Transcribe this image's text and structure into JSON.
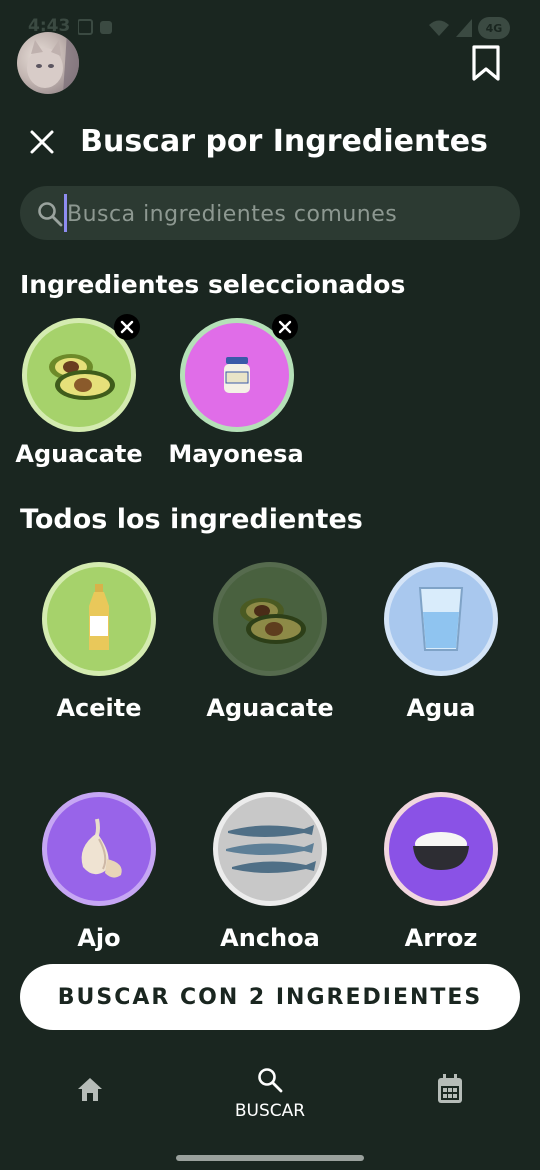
{
  "status_bar": {
    "time": "4:43",
    "network": "4G"
  },
  "header": {
    "title": "Buscar por Ingredientes"
  },
  "search": {
    "placeholder": "Busca ingredientes comunes"
  },
  "selected": {
    "heading": "Ingredientes seleccionados",
    "items": [
      {
        "label": "Aguacate",
        "icon": "avocado-icon",
        "bg": "#a6d26b",
        "ring": "#d4ebb0"
      },
      {
        "label": "Mayonesa",
        "icon": "mayonnaise-jar-icon",
        "bg": "#e06de8",
        "ring": "#b5e0b8"
      }
    ]
  },
  "all": {
    "heading": "Todos los ingredientes",
    "items": [
      {
        "label": "Aceite",
        "icon": "oil-bottle-icon",
        "bg": "#a6d26b",
        "ring": "#d4ebb0"
      },
      {
        "label": "Aguacate",
        "icon": "avocado-icon",
        "bg": "#49613f",
        "ring": "#566b4e"
      },
      {
        "label": "Agua",
        "icon": "water-glass-icon",
        "bg": "#a9c8ee",
        "ring": "#d4e4f7"
      },
      {
        "label": "Ajo",
        "icon": "garlic-icon",
        "bg": "#9864e9",
        "ring": "#c6a6f4"
      },
      {
        "label": "Anchoa",
        "icon": "anchovy-icon",
        "bg": "#c8c8c8",
        "ring": "#ececec"
      },
      {
        "label": "Arroz",
        "icon": "rice-bowl-icon",
        "bg": "#8a52e6",
        "ring": "#f1d6df"
      }
    ]
  },
  "cta": {
    "label": "BUSCAR CON 2 INGREDIENTES"
  },
  "bottom_nav": {
    "search_label": "BUSCAR"
  }
}
